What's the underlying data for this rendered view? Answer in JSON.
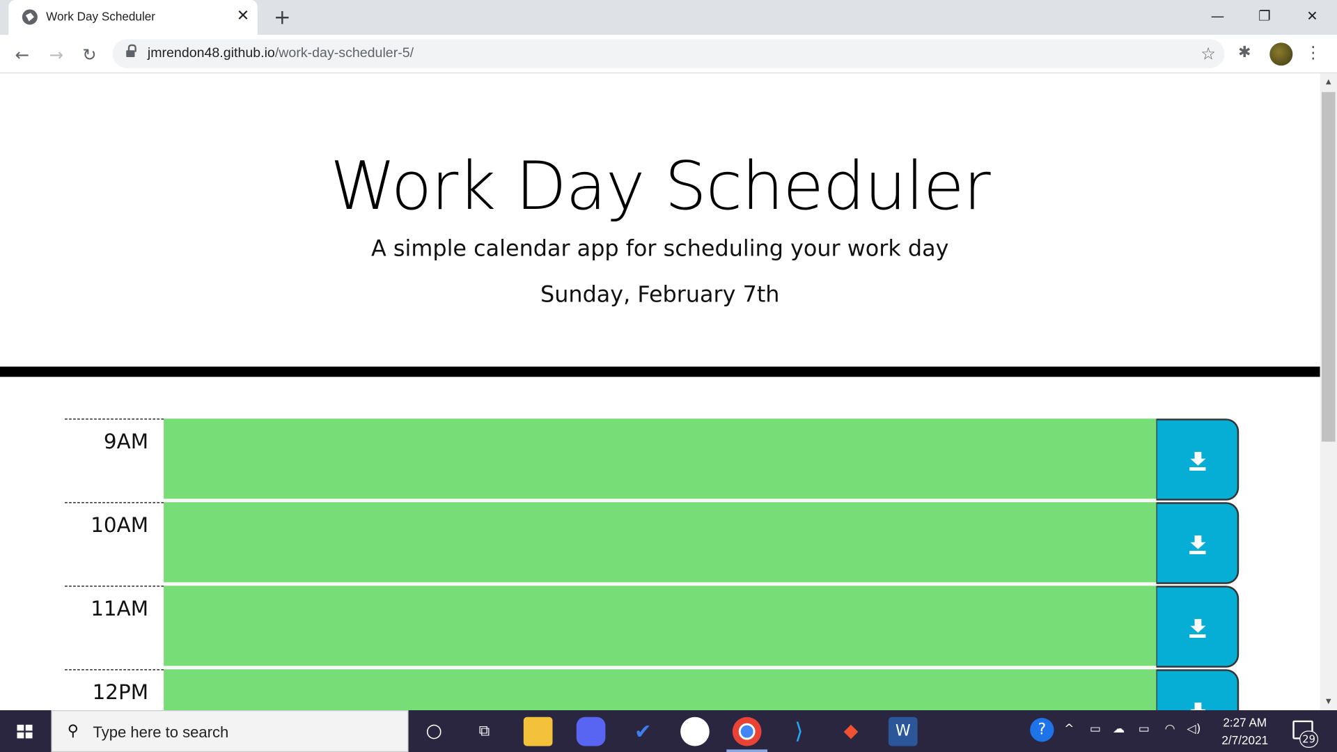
{
  "browser": {
    "tab_title": "Work Day Scheduler",
    "tab_close": "✕",
    "new_tab": "+",
    "url_host": "jmrendon48.github.io",
    "url_path": "/work-day-scheduler-5/",
    "win_minimize": "—",
    "win_restore": "❐",
    "win_close": "✕"
  },
  "page": {
    "title": "Work Day Scheduler",
    "lead": "A simple calendar app for scheduling your work day",
    "current_day": "Sunday, February 7th",
    "past_color": "#77dd77",
    "save_color": "#06aed5",
    "time_blocks": [
      {
        "hour": "9AM",
        "text": ""
      },
      {
        "hour": "10AM",
        "text": ""
      },
      {
        "hour": "11AM",
        "text": ""
      },
      {
        "hour": "12PM",
        "text": ""
      }
    ]
  },
  "taskbar": {
    "search_placeholder": "Type here to search",
    "time": "2:27 AM",
    "date": "2/7/2021",
    "notification_count": "29"
  }
}
